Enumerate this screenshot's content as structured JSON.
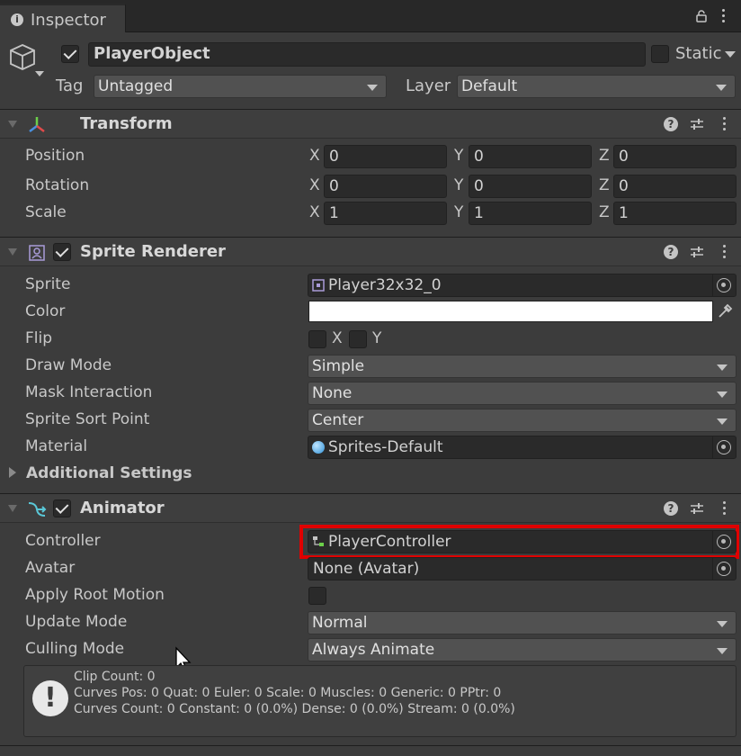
{
  "tab": {
    "title": "Inspector"
  },
  "object": {
    "name": "PlayerObject",
    "static_label": "Static",
    "tag_label": "Tag",
    "tag_value": "Untagged",
    "layer_label": "Layer",
    "layer_value": "Default"
  },
  "transform": {
    "title": "Transform",
    "rows": [
      {
        "label": "Position",
        "x": "0",
        "y": "0",
        "z": "0"
      },
      {
        "label": "Rotation",
        "x": "0",
        "y": "0",
        "z": "0"
      },
      {
        "label": "Scale",
        "x": "1",
        "y": "1",
        "z": "1"
      }
    ],
    "axis": {
      "x": "X",
      "y": "Y",
      "z": "Z"
    }
  },
  "sprite_renderer": {
    "title": "Sprite Renderer",
    "sprite_label": "Sprite",
    "sprite_value": "Player32x32_0",
    "color_label": "Color",
    "color_value": "#ffffff",
    "flip_label": "Flip",
    "flip_x": "X",
    "flip_y": "Y",
    "draw_mode_label": "Draw Mode",
    "draw_mode_value": "Simple",
    "mask_label": "Mask Interaction",
    "mask_value": "None",
    "sort_label": "Sprite Sort Point",
    "sort_value": "Center",
    "material_label": "Material",
    "material_value": "Sprites-Default",
    "additional": "Additional Settings"
  },
  "animator": {
    "title": "Animator",
    "controller_label": "Controller",
    "controller_value": "PlayerController",
    "avatar_label": "Avatar",
    "avatar_value": "None (Avatar)",
    "root_motion_label": "Apply Root Motion",
    "update_label": "Update Mode",
    "update_value": "Normal",
    "culling_label": "Culling Mode",
    "culling_value": "Always Animate",
    "info_lines": [
      "Clip Count: 0",
      "Curves Pos: 0 Quat: 0 Euler: 0 Scale: 0 Muscles: 0 Generic: 0 PPtr: 0",
      "Curves Count: 0 Constant: 0 (0.0%) Dense: 0 (0.0%) Stream: 0 (0.0%)"
    ]
  },
  "colors": {
    "highlight": "#e00000",
    "background": "#3c3c3c"
  }
}
